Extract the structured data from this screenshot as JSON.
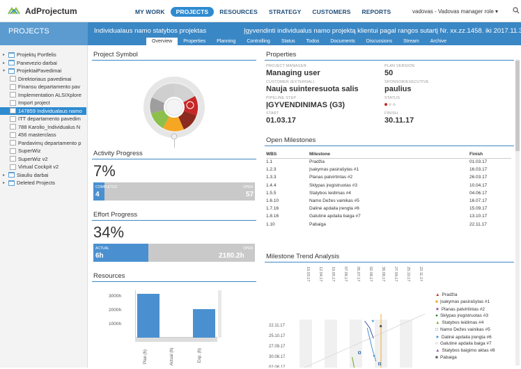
{
  "app": {
    "logo_text": "AdProjectum"
  },
  "nav": [
    "MY WORK",
    "PROJECTS",
    "RESOURCES",
    "STRATEGY",
    "CUSTOMERS",
    "REPORTS"
  ],
  "user": {
    "label": "vadovas - Vadovas manager role ▾"
  },
  "subheader": {
    "section": "PROJECTS",
    "project_name": "Individualaus namo statybos projektas",
    "project_desc": "Įgyvendinti individualus namo projektą klientui pagal rangos sutartį Nr. xx.zz.1458. iki 2017.11.30"
  },
  "tabs": [
    "Overview",
    "Properties",
    "Planning",
    "Controlling",
    "Status",
    "Todos",
    "Documents",
    "Discussions",
    "Stream",
    "Archive"
  ],
  "tree": [
    {
      "label": "Projektų Portfelis",
      "kind": "fold",
      "caret": "▸"
    },
    {
      "label": "Panevezio darbai",
      "kind": "fold",
      "caret": "▸"
    },
    {
      "label": "ProjektaiPavedimai",
      "kind": "fold",
      "caret": "▾"
    },
    {
      "label": "Direktoriaus pavedimai",
      "kind": "page",
      "caret": ""
    },
    {
      "label": "Finansu departamento pav",
      "kind": "page",
      "caret": ""
    },
    {
      "label": "Implementation ALSIXplore",
      "kind": "page",
      "caret": ""
    },
    {
      "label": "Import project",
      "kind": "page",
      "caret": ""
    },
    {
      "label": "147859 Individualaus namo",
      "kind": "page",
      "caret": "",
      "selected": true
    },
    {
      "label": "ITT departamento pavedim",
      "kind": "page",
      "caret": ""
    },
    {
      "label": "788 Karolio_Individualus N",
      "kind": "page",
      "caret": ""
    },
    {
      "label": "456 masterclass",
      "kind": "page",
      "caret": ""
    },
    {
      "label": "Pardavimų departamento p",
      "kind": "page",
      "caret": ""
    },
    {
      "label": "SuperWiz",
      "kind": "page",
      "caret": ""
    },
    {
      "label": "SuperWiz v2",
      "kind": "page",
      "caret": ""
    },
    {
      "label": "Virtual Cockpit v2",
      "kind": "page",
      "caret": ""
    },
    {
      "label": "Siauliu darbai",
      "kind": "fold",
      "caret": "▸"
    },
    {
      "label": "Deleted Projects",
      "kind": "fold",
      "caret": "▸"
    }
  ],
  "project_symbol": {
    "title": "Project Symbol"
  },
  "properties": {
    "title": "Properties",
    "pm_label": "PROJECT MANAGER",
    "pm_value": "Managing user",
    "plan_label": "PLAN VERSION",
    "plan_value": "50",
    "customer_label": "CUSTOMER (EXTERNAL)",
    "customer_value": "Nauja suinteresuota salis",
    "sponsor_label": "SPONSOR/EXECUTIVE",
    "sponsor_value": "paulius",
    "pipeline_label": "PIPELINE STEP",
    "pipeline_value": "ĮGYVENDINIMAS (G3)",
    "status_label": "STATUS",
    "start_label": "START",
    "start_value": "01.03.17",
    "finish_label": "FINISH",
    "finish_value": "30.11.17"
  },
  "activity": {
    "title": "Activity Progress",
    "pct": "7%",
    "completed_label": "COMPLETED",
    "completed_value": "4",
    "open_label": "OPEN",
    "open_value": "57",
    "fraction": 0.07
  },
  "effort": {
    "title": "Effort Progress",
    "pct": "34%",
    "actual_label": "ACTUAL",
    "actual_value": "6h",
    "open_label": "OPEN",
    "open_value": "2180.2h",
    "fraction": 0.34
  },
  "resources": {
    "title": "Resources",
    "y_ticks": [
      "3000h",
      "2000h",
      "1000h"
    ],
    "x_labels": [
      "Plan (h)",
      "Actual (h)",
      "Exp. (h)"
    ]
  },
  "milestones": {
    "title": "Open Milestones",
    "headers": [
      "WBS",
      "Milestone",
      "Finish"
    ],
    "rows": [
      [
        "1.1",
        "Pradžia",
        "01.03.17"
      ],
      [
        "1.2.3",
        "Įsakymas pasirašytas #1",
        "16.03.17"
      ],
      [
        "1.3.3",
        "Planas patvirtintas #2",
        "26.03.17"
      ],
      [
        "1.4.4",
        "Sklypas įregistruotas #3",
        "10.04.17"
      ],
      [
        "1.5.5",
        "Statybos leidimas #4",
        "04.06.17"
      ],
      [
        "1.6.10",
        "Namo Dežes vainikas #5",
        "16.07.17"
      ],
      [
        "1.7.16",
        "Dalinė apdaila įrengta #6",
        "15.09.17"
      ],
      [
        "1.8.16",
        "Galutinė apdaila baiga #7",
        "13.10.17"
      ],
      [
        "1.10",
        "Pabaiga",
        "22.11.17"
      ]
    ]
  },
  "trend": {
    "title": "Milestone Trend Analysis",
    "x_ticks": [
      "15.03.17",
      "12.04.17",
      "10.05.17",
      "07.06.17",
      "05.07.17",
      "02.08.17",
      "30.08.17",
      "27.09.17",
      "25.10.17",
      "22.11.17"
    ],
    "y_ticks": [
      "22.11.17",
      "25.10.17",
      "27.09.17",
      "30.08.17",
      "02.08.17",
      "05.07.17"
    ],
    "legend": [
      {
        "label": "Pradžia",
        "symbol": "▲",
        "color": "#c0392b"
      },
      {
        "label": "Įsakymas pasirašytas #1",
        "symbol": "■",
        "color": "#f0a830"
      },
      {
        "label": "Planas patvirtintas #2",
        "symbol": "★",
        "color": "#8e3fa0"
      },
      {
        "label": "Sklypas įregistruotas #3",
        "symbol": "●",
        "color": "#2e7d32"
      },
      {
        "label": "Statybos leidimas #4",
        "symbol": "▲",
        "color": "#7cb342"
      },
      {
        "label": "Namo Dežes vainikas #5",
        "symbol": "□",
        "color": "#3a6ea5"
      },
      {
        "label": "Dalinė apdaila įrengta #6",
        "symbol": "★",
        "color": "#4a90d0"
      },
      {
        "label": "Galutinė apdaila baiga #7",
        "symbol": "○",
        "color": "#555555"
      },
      {
        "label": "Statybos baigimo aktas #8",
        "symbol": "▲",
        "color": "#9b59b6"
      },
      {
        "label": "Pabaiga",
        "symbol": "■",
        "color": "#555555"
      }
    ]
  },
  "colors": {
    "accent": "#3a87c5",
    "bar": "#4a90d0"
  }
}
